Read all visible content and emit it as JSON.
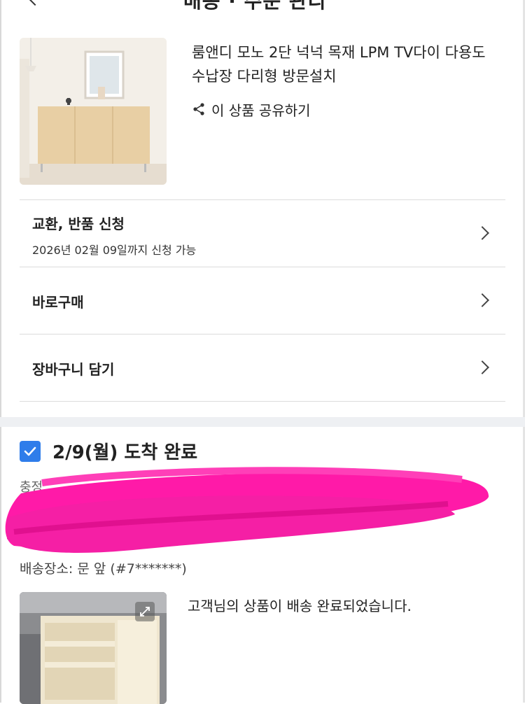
{
  "header": {
    "title": "배송 · 주문 관리"
  },
  "product": {
    "name_line1": "룸앤디 모노 2단 넉넉 목재 LPM TV다이 다용도",
    "name_line2": "수납장 다리형 방문설치",
    "share_label": "이 상품 공유하기"
  },
  "actions": [
    {
      "label": "교환, 반품 신청",
      "sub": "2026년 02월 09일까지 신청 가능"
    },
    {
      "label": "바로구매"
    },
    {
      "label": "장바구니 담기"
    }
  ],
  "delivery": {
    "title": "2/9(월) 도착 완료",
    "receiver_partial": "충정",
    "location": "배송장소: 문 앞 (#7*******)",
    "message": "고객님의 상품이 배송 완료되었습니다.",
    "checked": true
  },
  "colors": {
    "accent": "#2f7dea",
    "redaction": "#ff1aa8"
  },
  "icons": {
    "back": "back-arrow-icon",
    "share": "share-icon",
    "chevron": "chevron-right-icon",
    "check": "check-icon",
    "expand": "expand-icon"
  }
}
